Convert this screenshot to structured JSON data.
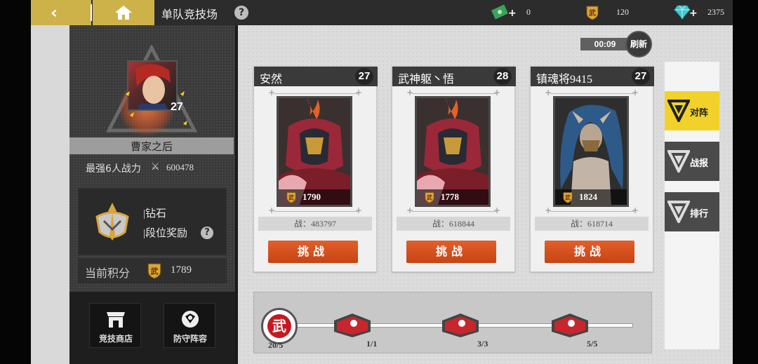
{
  "header": {
    "title": "单队竞技场",
    "resources": [
      {
        "icon": "cash-icon",
        "value": "0"
      },
      {
        "icon": "martial-token-icon",
        "value": "120"
      },
      {
        "icon": "diamond-icon",
        "value": "2375"
      }
    ]
  },
  "player": {
    "level": "27",
    "name": "曹家之后",
    "power_label": "最强6人战力",
    "power_value": "600478",
    "rank_name": "|钻石",
    "rank_reward": "|段位奖励",
    "score_label": "当前积分",
    "score_value": "1789",
    "shop_label": "竞技商店",
    "defense_label": "防守阵容"
  },
  "refresh": {
    "timer": "00:09",
    "label": "刷新"
  },
  "opponents": [
    {
      "name": "安然",
      "level": "27",
      "score": "1790",
      "power": "战：483797",
      "button": "挑战"
    },
    {
      "name": "武神躯丶悟",
      "level": "28",
      "score": "1778",
      "power": "战：618844",
      "button": "挑战"
    },
    {
      "name": "镇魂将9415",
      "level": "27",
      "score": "1824",
      "power": "战：618714",
      "button": "挑战"
    }
  ],
  "tabs": [
    {
      "label": "对阵",
      "active": true
    },
    {
      "label": "战报",
      "active": false
    },
    {
      "label": "排行",
      "active": false
    }
  ],
  "progress": {
    "start_glyph": "武",
    "start_count": "20/5",
    "chests": [
      {
        "label": "1/1"
      },
      {
        "label": "3/3"
      },
      {
        "label": "5/5"
      }
    ]
  },
  "colors": {
    "accent_gold": "#cdb24a",
    "challenge_orange": "#d9501f",
    "active_tab_yellow": "#f2d22a"
  }
}
